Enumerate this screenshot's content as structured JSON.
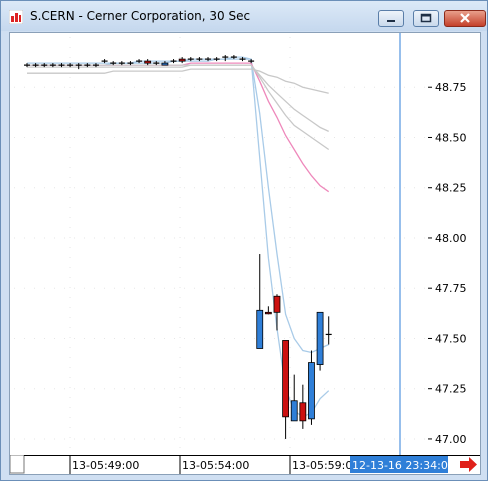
{
  "window": {
    "title": "S.CERN - Cerner Corporation, 30 Sec",
    "icon": "bar-chart-app-icon",
    "buttons": [
      "minimize",
      "maximize",
      "close"
    ]
  },
  "chart": {
    "price_labels": [
      "48.75",
      "48.50",
      "48.25",
      "48.00",
      "47.75",
      "47.50",
      "47.25",
      "47.00"
    ],
    "time_labels": [
      "13-05:49:00",
      "13-05:54:00",
      "13-05:59:00"
    ],
    "cursor_label": "12-13-16 23:34:00",
    "colors": {
      "up": "#2f7fd8",
      "down": "#cc1111",
      "ma_light": "#a9cbe8",
      "ma_gray": "#c8c8c8",
      "ma_pink": "#ee88bb",
      "cursor": "#2f7fd8",
      "arrow": "#e0201a"
    },
    "scroll_arrow_icon": "right-arrow-icon"
  },
  "chart_data": {
    "type": "candlestick",
    "ylim": [
      46.94,
      48.98
    ],
    "candles": [
      {
        "o": 48.86,
        "h": 48.87,
        "l": 48.85,
        "c": 48.86,
        "dir": "flat"
      },
      {
        "o": 48.86,
        "h": 48.87,
        "l": 48.85,
        "c": 48.86,
        "dir": "flat"
      },
      {
        "o": 48.86,
        "h": 48.87,
        "l": 48.85,
        "c": 48.86,
        "dir": "flat"
      },
      {
        "o": 48.86,
        "h": 48.87,
        "l": 48.85,
        "c": 48.86,
        "dir": "flat"
      },
      {
        "o": 48.86,
        "h": 48.87,
        "l": 48.85,
        "c": 48.86,
        "dir": "flat"
      },
      {
        "o": 48.86,
        "h": 48.87,
        "l": 48.85,
        "c": 48.86,
        "dir": "flat"
      },
      {
        "o": 48.85,
        "h": 48.87,
        "l": 48.84,
        "c": 48.86,
        "dir": "flat"
      },
      {
        "o": 48.86,
        "h": 48.87,
        "l": 48.85,
        "c": 48.86,
        "dir": "flat"
      },
      {
        "o": 48.86,
        "h": 48.87,
        "l": 48.85,
        "c": 48.86,
        "dir": "flat"
      },
      {
        "o": 48.87,
        "h": 48.89,
        "l": 48.87,
        "c": 48.88,
        "dir": "flat"
      },
      {
        "o": 48.87,
        "h": 48.88,
        "l": 48.86,
        "c": 48.87,
        "dir": "flat"
      },
      {
        "o": 48.87,
        "h": 48.88,
        "l": 48.86,
        "c": 48.87,
        "dir": "flat"
      },
      {
        "o": 48.87,
        "h": 48.88,
        "l": 48.86,
        "c": 48.87,
        "dir": "flat"
      },
      {
        "o": 48.88,
        "h": 48.89,
        "l": 48.87,
        "c": 48.88,
        "dir": "flat"
      },
      {
        "o": 48.88,
        "h": 48.89,
        "l": 48.86,
        "c": 48.87,
        "dir": "down"
      },
      {
        "o": 48.87,
        "h": 48.88,
        "l": 48.86,
        "c": 48.87,
        "dir": "flat"
      },
      {
        "o": 48.86,
        "h": 48.88,
        "l": 48.86,
        "c": 48.87,
        "dir": "up"
      },
      {
        "o": 48.88,
        "h": 48.89,
        "l": 48.87,
        "c": 48.88,
        "dir": "flat"
      },
      {
        "o": 48.89,
        "h": 48.9,
        "l": 48.87,
        "c": 48.88,
        "dir": "down"
      },
      {
        "o": 48.88,
        "h": 48.9,
        "l": 48.88,
        "c": 48.89,
        "dir": "flat"
      },
      {
        "o": 48.88,
        "h": 48.9,
        "l": 48.88,
        "c": 48.89,
        "dir": "flat"
      },
      {
        "o": 48.89,
        "h": 48.9,
        "l": 48.88,
        "c": 48.89,
        "dir": "flat"
      },
      {
        "o": 48.89,
        "h": 48.9,
        "l": 48.88,
        "c": 48.89,
        "dir": "flat"
      },
      {
        "o": 48.89,
        "h": 48.91,
        "l": 48.88,
        "c": 48.9,
        "dir": "flat"
      },
      {
        "o": 48.9,
        "h": 48.91,
        "l": 48.89,
        "c": 48.9,
        "dir": "flat"
      },
      {
        "o": 48.89,
        "h": 48.9,
        "l": 48.88,
        "c": 48.89,
        "dir": "flat"
      },
      {
        "o": 48.88,
        "h": 48.89,
        "l": 48.87,
        "c": 48.88,
        "dir": "flat"
      },
      {
        "o": 47.45,
        "h": 47.92,
        "l": 47.45,
        "c": 47.64,
        "dir": "up"
      },
      {
        "o": 47.63,
        "h": 47.66,
        "l": 47.62,
        "c": 47.63,
        "dir": "down"
      },
      {
        "o": 47.71,
        "h": 47.72,
        "l": 47.54,
        "c": 47.63,
        "dir": "down"
      },
      {
        "o": 47.49,
        "h": 47.49,
        "l": 47.0,
        "c": 47.11,
        "dir": "down"
      },
      {
        "o": 47.09,
        "h": 47.32,
        "l": 47.09,
        "c": 47.19,
        "dir": "up"
      },
      {
        "o": 47.18,
        "h": 47.27,
        "l": 47.05,
        "c": 47.09,
        "dir": "down"
      },
      {
        "o": 47.1,
        "h": 47.44,
        "l": 47.07,
        "c": 47.38,
        "dir": "up"
      },
      {
        "o": 47.37,
        "h": 47.63,
        "l": 47.34,
        "c": 47.63,
        "dir": "up"
      },
      {
        "o": 47.52,
        "h": 47.61,
        "l": 47.47,
        "c": 47.52,
        "dir": "flat"
      }
    ],
    "ma_series": [
      {
        "color": "ma_light",
        "values": [
          48.86,
          48.86,
          48.86,
          48.86,
          48.86,
          48.86,
          48.86,
          48.86,
          48.86,
          48.86,
          48.87,
          48.87,
          48.87,
          48.87,
          48.87,
          48.87,
          48.87,
          48.88,
          48.88,
          48.88,
          48.88,
          48.88,
          48.89,
          48.89,
          48.89,
          48.89,
          48.89,
          48.4,
          47.9,
          47.55,
          47.25,
          47.14,
          47.11,
          47.13,
          47.2,
          47.24
        ]
      },
      {
        "color": "ma_light",
        "values": [
          48.87,
          48.87,
          48.87,
          48.87,
          48.87,
          48.87,
          48.87,
          48.87,
          48.87,
          48.87,
          48.87,
          48.87,
          48.87,
          48.88,
          48.88,
          48.88,
          48.88,
          48.88,
          48.88,
          48.89,
          48.89,
          48.89,
          48.89,
          48.89,
          48.9,
          48.9,
          48.89,
          48.62,
          48.25,
          47.92,
          47.62,
          47.5,
          47.44,
          47.43,
          47.45,
          47.47
        ]
      },
      {
        "color": "ma_pink",
        "values": [
          48.86,
          48.86,
          48.86,
          48.86,
          48.86,
          48.86,
          48.86,
          48.86,
          48.86,
          48.86,
          48.86,
          48.86,
          48.86,
          48.86,
          48.86,
          48.86,
          48.86,
          48.86,
          48.86,
          48.87,
          48.87,
          48.87,
          48.87,
          48.87,
          48.87,
          48.87,
          48.87,
          48.78,
          48.68,
          48.6,
          48.51,
          48.44,
          48.37,
          48.31,
          48.26,
          48.23
        ]
      },
      {
        "color": "ma_gray",
        "values": [
          48.85,
          48.85,
          48.85,
          48.85,
          48.85,
          48.85,
          48.85,
          48.85,
          48.85,
          48.85,
          48.85,
          48.85,
          48.85,
          48.85,
          48.85,
          48.85,
          48.85,
          48.85,
          48.85,
          48.86,
          48.86,
          48.86,
          48.86,
          48.86,
          48.86,
          48.86,
          48.86,
          48.8,
          48.73,
          48.67,
          48.61,
          48.56,
          48.53,
          48.5,
          48.47,
          48.44
        ]
      },
      {
        "color": "ma_gray",
        "values": [
          48.86,
          48.86,
          48.86,
          48.86,
          48.86,
          48.86,
          48.86,
          48.86,
          48.86,
          48.86,
          48.86,
          48.86,
          48.86,
          48.86,
          48.86,
          48.86,
          48.86,
          48.86,
          48.86,
          48.86,
          48.86,
          48.86,
          48.86,
          48.86,
          48.86,
          48.86,
          48.86,
          48.81,
          48.76,
          48.72,
          48.68,
          48.64,
          48.61,
          48.58,
          48.55,
          48.53
        ]
      },
      {
        "color": "ma_gray",
        "values": [
          48.82,
          48.82,
          48.82,
          48.82,
          48.82,
          48.82,
          48.82,
          48.82,
          48.82,
          48.82,
          48.83,
          48.83,
          48.83,
          48.83,
          48.83,
          48.83,
          48.83,
          48.83,
          48.83,
          48.84,
          48.84,
          48.84,
          48.84,
          48.84,
          48.84,
          48.84,
          48.84,
          48.83,
          48.81,
          48.8,
          48.78,
          48.77,
          48.75,
          48.74,
          48.73,
          48.72
        ]
      }
    ]
  }
}
